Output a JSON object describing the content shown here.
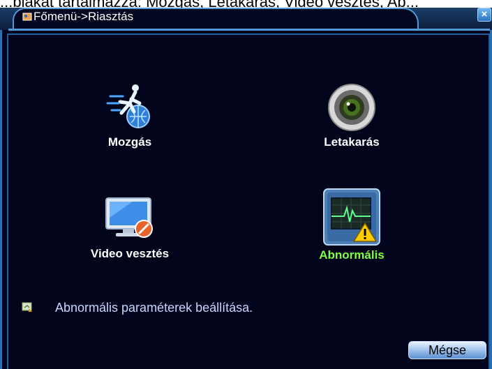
{
  "caption": "...blakat tartalmazza: Mozgás, Letakarás, Video vesztés, Ab...",
  "window": {
    "title": "Főmenü->Riasztás",
    "close_label": "×"
  },
  "items": [
    {
      "label": "Mozgás",
      "icon": "running-person-icon",
      "selected": false
    },
    {
      "label": "Letakarás",
      "icon": "camera-lens-icon",
      "selected": false
    },
    {
      "label": "Video vesztés",
      "icon": "monitor-video-loss-icon",
      "selected": false
    },
    {
      "label": "Abnormális",
      "icon": "abnormal-warning-icon",
      "selected": true
    }
  ],
  "hint": "Abnormális paraméterek beállítása.",
  "buttons": {
    "cancel": "Mégse"
  },
  "colors": {
    "background": "#02041b",
    "selected_label": "#7dff3a",
    "hint_text": "#c9d6ff",
    "border": "#4f9ad8"
  }
}
